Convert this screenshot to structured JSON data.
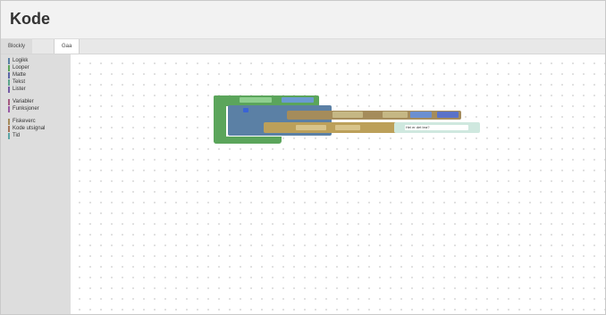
{
  "app": {
    "title": "Kode"
  },
  "tabs": [
    {
      "label": "Blockly",
      "active": true
    },
    {
      "label": "Gaa",
      "active": false
    }
  ],
  "toolbox": {
    "groups": [
      [
        {
          "label": "Logikk",
          "color": "#5b80a5"
        },
        {
          "label": "Looper",
          "color": "#5ba55b"
        },
        {
          "label": "Matte",
          "color": "#5b67a5"
        },
        {
          "label": "Tekst",
          "color": "#5ba58c"
        },
        {
          "label": "Lister",
          "color": "#745ba5"
        }
      ],
      [
        {
          "label": "Variabler",
          "color": "#a55b80"
        },
        {
          "label": "Funksjoner",
          "color": "#995ba5"
        }
      ],
      [
        {
          "label": "Fiskeverc",
          "color": "#a58c5b"
        },
        {
          "label": "Kode utsignal",
          "color": "#a5745b"
        },
        {
          "label": "Tid",
          "color": "#5ba5a5"
        }
      ]
    ]
  },
  "workspace": {
    "text_field_value": "Hei er det bra?"
  },
  "colors": {
    "loop_block": "#5ba55b",
    "logic_block": "#5b80a5",
    "variable_block": "#a58c5b",
    "text_block": "#5ba58c",
    "workspace_bg": "#ffffff",
    "toolbox_bg": "#dddddd"
  }
}
